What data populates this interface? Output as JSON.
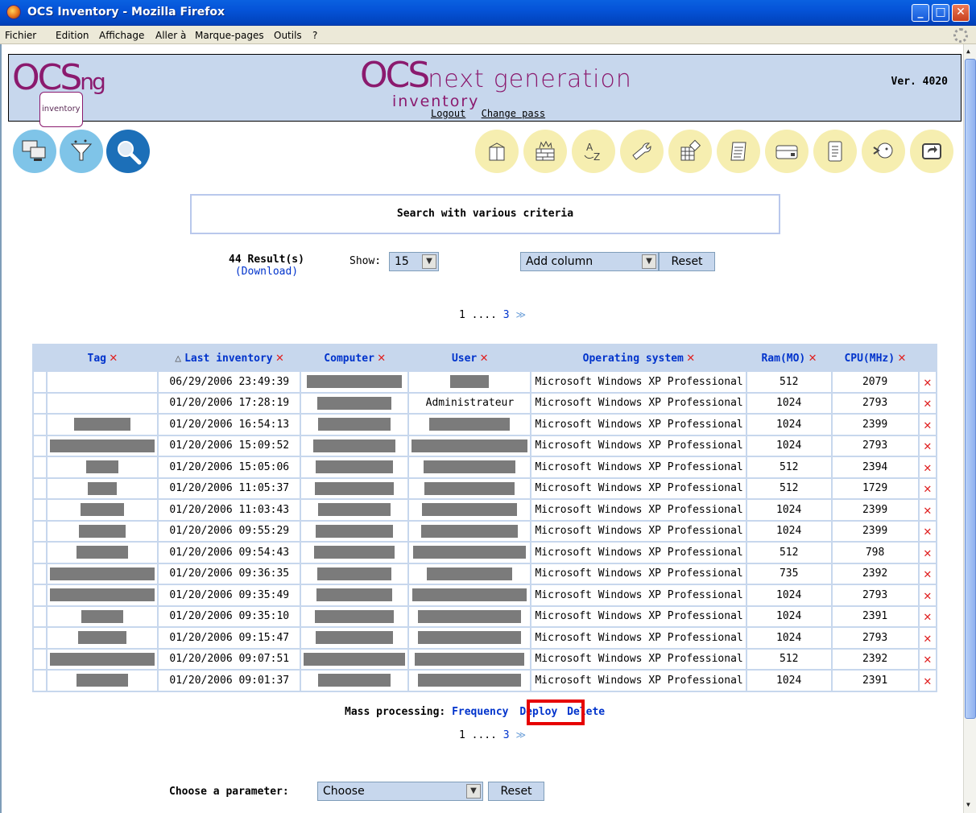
{
  "window": {
    "title": "OCS Inventory - Mozilla Firefox",
    "min": "_",
    "max": "□",
    "close": "✕"
  },
  "menu": [
    "Fichier",
    "Edition",
    "Affichage",
    "Aller à",
    "Marque-pages",
    "Outils",
    "?"
  ],
  "header": {
    "logo_main": "OCS",
    "logo_ng": "ng",
    "logo_sub": "inventory",
    "title_ocs": "OCS",
    "title_next": "next",
    "title_gen": "generation",
    "title_inv": "inventory",
    "version": "Ver. 4020",
    "logout": "Logout",
    "change_pass": "Change pass"
  },
  "icons_left": [
    "computers-icon",
    "filter-icon",
    "search-icon"
  ],
  "icons_right": [
    "package-icon",
    "firewall-icon",
    "dictionary-icon",
    "tools-icon",
    "registry-icon",
    "script-icon",
    "device-icon",
    "document-icon",
    "help-icon",
    "back-icon"
  ],
  "search": {
    "title": "Search with various criteria"
  },
  "results": {
    "count": "44 Result(s)",
    "download": "(Download)"
  },
  "show": {
    "label": "Show:",
    "value": "15"
  },
  "add_column": {
    "value": "Add column",
    "reset": "Reset"
  },
  "pager": {
    "first": "1",
    "dots": "....",
    "last": "3",
    "next": "≫"
  },
  "table": {
    "columns": [
      "Tag",
      "Last inventory",
      "Computer",
      "User",
      "Operating system",
      "Ram(MO)",
      "CPU(MHz)"
    ],
    "rows": [
      {
        "last": "06/29/2006 23:49:39",
        "user": "",
        "os": "Microsoft Windows XP Professional",
        "ram": "512",
        "cpu": "2079"
      },
      {
        "last": "01/20/2006 17:28:19",
        "user": "Administrateur",
        "os": "Microsoft Windows XP Professional",
        "ram": "1024",
        "cpu": "2793"
      },
      {
        "last": "01/20/2006 16:54:13",
        "user": "",
        "os": "Microsoft Windows XP Professional",
        "ram": "1024",
        "cpu": "2399"
      },
      {
        "last": "01/20/2006 15:09:52",
        "user": "",
        "os": "Microsoft Windows XP Professional",
        "ram": "1024",
        "cpu": "2793"
      },
      {
        "last": "01/20/2006 15:05:06",
        "user": "",
        "os": "Microsoft Windows XP Professional",
        "ram": "512",
        "cpu": "2394"
      },
      {
        "last": "01/20/2006 11:05:37",
        "user": "",
        "os": "Microsoft Windows XP Professional",
        "ram": "512",
        "cpu": "1729"
      },
      {
        "last": "01/20/2006 11:03:43",
        "user": "",
        "os": "Microsoft Windows XP Professional",
        "ram": "1024",
        "cpu": "2399"
      },
      {
        "last": "01/20/2006 09:55:29",
        "user": "",
        "os": "Microsoft Windows XP Professional",
        "ram": "1024",
        "cpu": "2399"
      },
      {
        "last": "01/20/2006 09:54:43",
        "user": "",
        "os": "Microsoft Windows XP Professional",
        "ram": "512",
        "cpu": "798"
      },
      {
        "last": "01/20/2006 09:36:35",
        "user": "",
        "os": "Microsoft Windows XP Professional",
        "ram": "735",
        "cpu": "2392"
      },
      {
        "last": "01/20/2006 09:35:49",
        "user": "",
        "os": "Microsoft Windows XP Professional",
        "ram": "1024",
        "cpu": "2793"
      },
      {
        "last": "01/20/2006 09:35:10",
        "user": "",
        "os": "Microsoft Windows XP Professional",
        "ram": "1024",
        "cpu": "2391"
      },
      {
        "last": "01/20/2006 09:15:47",
        "user": "",
        "os": "Microsoft Windows XP Professional",
        "ram": "1024",
        "cpu": "2793"
      },
      {
        "last": "01/20/2006 09:07:51",
        "user": "",
        "os": "Microsoft Windows XP Professional",
        "ram": "512",
        "cpu": "2392"
      },
      {
        "last": "01/20/2006 09:01:37",
        "user": "",
        "os": "Microsoft Windows XP Professional",
        "ram": "1024",
        "cpu": "2391"
      }
    ]
  },
  "mass": {
    "label": "Mass processing:",
    "frequency": "Frequency",
    "deploy": "Deploy",
    "delete": "Delete"
  },
  "param": {
    "label": "Choose a parameter:",
    "value": "Choose",
    "reset": "Reset"
  },
  "colors": {
    "header_bg": "#c7d7ed",
    "link": "#0033cc",
    "delete": "#e02020",
    "highlight": "#e60000"
  }
}
